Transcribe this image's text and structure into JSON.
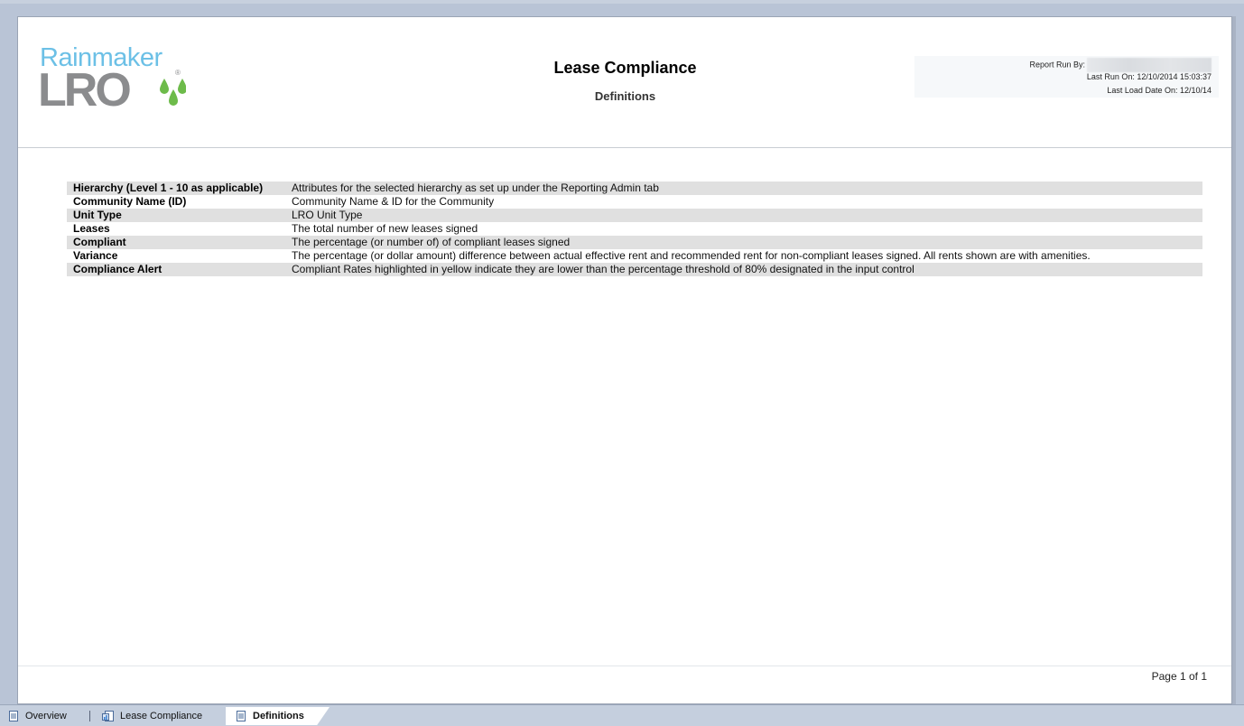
{
  "report": {
    "title": "Lease Compliance",
    "subtitle": "Definitions",
    "run_by_label": "Report Run By:",
    "last_run": "Last Run On: 12/10/2014 15:03:37",
    "last_load": "Last Load Date On: 12/10/14",
    "page_number": "Page 1 of 1"
  },
  "logo": {
    "top_text": "Rainmaker",
    "bottom_text": "LRO",
    "registered": "®",
    "colors": {
      "top": "#6cc0e6",
      "bottom": "#8b8c8e",
      "drops": "#6dbb4a"
    }
  },
  "definitions": [
    {
      "term": "Hierarchy (Level 1 - 10 as applicable)",
      "description": "Attributes for the selected hierarchy as set up under the Reporting Admin tab"
    },
    {
      "term": "Community Name (ID)",
      "description": "Community Name & ID for the Community"
    },
    {
      "term": "Unit Type",
      "description": "LRO Unit Type"
    },
    {
      "term": "Leases",
      "description": "The total number of new leases signed"
    },
    {
      "term": "Compliant",
      "description": "The percentage (or number of)  of compliant leases signed"
    },
    {
      "term": "Variance",
      "description": "The percentage (or dollar amount) difference between actual effective rent and recommended rent for non-compliant leases signed. All rents shown are with amenities."
    },
    {
      "term": "Compliance Alert",
      "description": "Compliant Rates highlighted in yellow indicate they are lower than the percentage threshold of 80% designated in the input control"
    }
  ],
  "tabs": [
    {
      "label": "Overview",
      "icon": "document-icon",
      "active": false
    },
    {
      "label": "Lease Compliance",
      "icon": "chart-document-icon",
      "active": false
    },
    {
      "label": "Definitions",
      "icon": "document-icon",
      "active": true
    }
  ]
}
